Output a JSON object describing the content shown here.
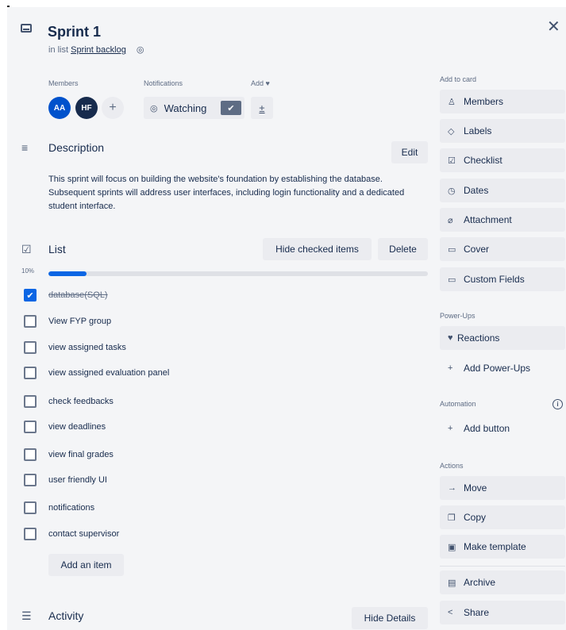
{
  "card": {
    "title": "Sprint 1",
    "list_prefix": "in list",
    "list_name": "Sprint backlog"
  },
  "labels": {
    "members": "Members",
    "notifications": "Notifications",
    "add": "Add ♥"
  },
  "members": [
    {
      "initials": "AA",
      "color": "#0052cc"
    },
    {
      "initials": "HF",
      "color": "#172b4d"
    }
  ],
  "watch": {
    "label": "Watching",
    "checked": true
  },
  "add_button_label": "±",
  "description": {
    "heading": "Description",
    "edit_label": "Edit",
    "text": "This sprint will focus on building the website's foundation by establishing the database. Subsequent sprints will address user interfaces, including login functionality and a dedicated student interface."
  },
  "checklist": {
    "heading": "List",
    "hide_checked_label": "Hide checked items",
    "delete_label": "Delete",
    "progress_label": "10%",
    "progress_fraction": 0.1,
    "items": [
      {
        "text": "database(SQL)",
        "checked": true
      },
      {
        "text": "View FYP group",
        "checked": false
      },
      {
        "text": "view assigned tasks",
        "checked": false
      },
      {
        "text": "view assigned evaluation panel",
        "checked": false
      },
      {
        "text": "check feedbacks",
        "checked": false
      },
      {
        "text": "view deadlines",
        "checked": false
      },
      {
        "text": "view final grades",
        "checked": false
      },
      {
        "text": "user friendly UI",
        "checked": false
      },
      {
        "text": "notifications",
        "checked": false
      },
      {
        "text": "contact supervisor",
        "checked": false
      }
    ],
    "add_item_label": "Add an item"
  },
  "activity": {
    "heading": "Activity",
    "hide_details_label": "Hide Details"
  },
  "sidebar": {
    "add_to_card_label": "Add to card",
    "add_to_card": [
      {
        "label": "Members",
        "icon": "person-icon"
      },
      {
        "label": "Labels",
        "icon": "tag-icon"
      },
      {
        "label": "Checklist",
        "icon": "checklist-icon"
      },
      {
        "label": "Dates",
        "icon": "clock-icon"
      },
      {
        "label": "Attachment",
        "icon": "paperclip-icon"
      },
      {
        "label": "Cover",
        "icon": "cover-icon"
      },
      {
        "label": "Custom Fields",
        "icon": "custom-fields-icon"
      }
    ],
    "powerups_label": "Power-Ups",
    "reactions_label": "Reactions",
    "add_powerups_label": "Add Power-Ups",
    "automation_label": "Automation",
    "add_button_label": "Add button",
    "actions_label": "Actions",
    "actions": [
      {
        "label": "Move",
        "icon": "arrow-right-icon"
      },
      {
        "label": "Copy",
        "icon": "copy-icon"
      },
      {
        "label": "Make template",
        "icon": "template-icon"
      },
      {
        "label": "Archive",
        "icon": "archive-icon"
      },
      {
        "label": "Share",
        "icon": "share-icon"
      }
    ]
  },
  "colors": {
    "accent": "#0c66e4",
    "panel_bg": "#f4f5f7",
    "button_bg": "#ebecf0",
    "text": "#172b4d"
  }
}
